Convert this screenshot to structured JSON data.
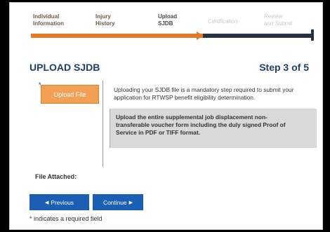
{
  "progress": {
    "steps": [
      {
        "label_line1": "Individual",
        "label_line2": "Information"
      },
      {
        "label_line1": "Injury",
        "label_line2": "History"
      },
      {
        "label_line1": "Upload",
        "label_line2": "SJDB"
      },
      {
        "label_line1": "Certification",
        "label_line2": ""
      },
      {
        "label_line1": "Review",
        "label_line2": "and Submit"
      }
    ],
    "completed_color": "#e07a2a",
    "remaining_color": "#253341"
  },
  "page": {
    "title": "UPLOAD SJDB",
    "step_counter": "Step 3 of 5"
  },
  "upload": {
    "required_marker": "*",
    "button_label": "Upload File",
    "button_color": "#f3a055",
    "description": "Uploading your SJDB file is a mandatory step required to submit your application for RTWSP benefit eligibility determination.",
    "instruction": "Upload the entire supplemental job displacement non-transferable voucher form including the duly signed Proof of Service in PDF or TIFF format."
  },
  "file_attached": {
    "label": "File Attached:"
  },
  "navigation": {
    "previous_label": "Previous",
    "continue_label": "Continue",
    "previous_icon": "triangle-left-icon",
    "continue_icon": "triangle-right-icon",
    "button_color": "#1a5fb4"
  },
  "footnote": "* indicates a required field"
}
